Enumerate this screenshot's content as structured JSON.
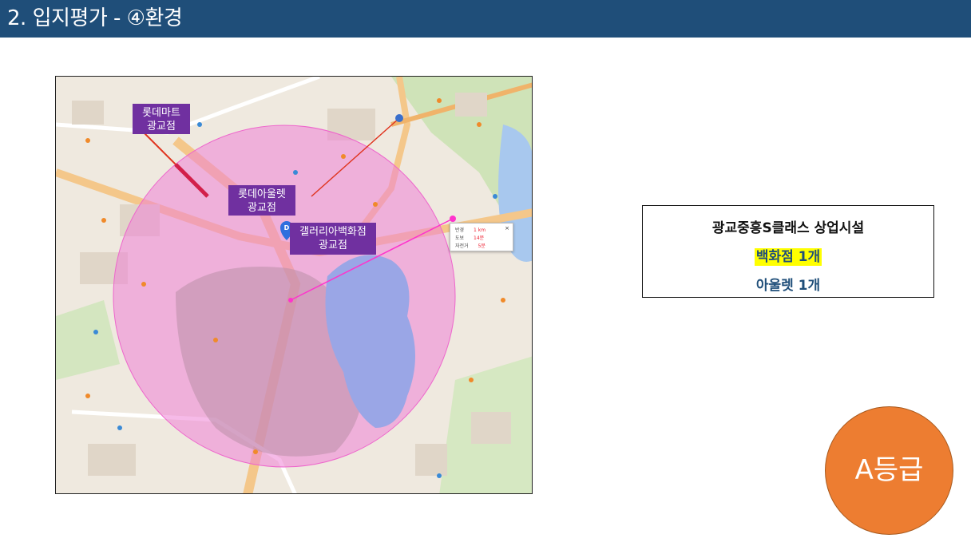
{
  "header": {
    "title": "2. 입지평가 - ④환경"
  },
  "map": {
    "labels": {
      "mart": [
        "롯데마트",
        "광교점"
      ],
      "outlet": [
        "롯데아울렛",
        "광교점"
      ],
      "gallery": [
        "갤러리아백화점",
        "광교점"
      ]
    },
    "popup": {
      "rows": [
        {
          "key": "반경",
          "value": "1 km"
        },
        {
          "key": "도보",
          "value": "14분"
        },
        {
          "key": "자전거",
          "value": "5분"
        }
      ],
      "close": "×"
    },
    "pin_letter": "D",
    "colors": {
      "radius_fill": "#ee82d6",
      "water": "#9aa6e6",
      "label_bg": "#7030a0"
    }
  },
  "infobox": {
    "title": "광교중흥S클래스 상업시설",
    "line2": "백화점 1개",
    "line3": "아울렛 1개"
  },
  "grade": {
    "label": "A등급",
    "color": "#ed7d31"
  }
}
